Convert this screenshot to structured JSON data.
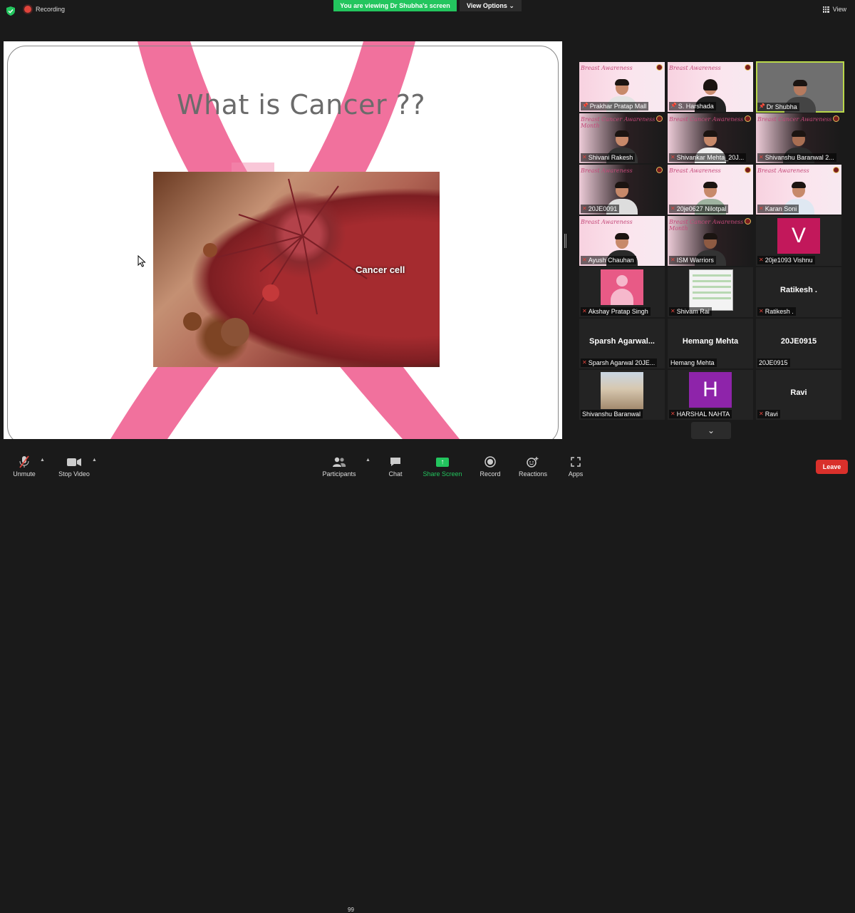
{
  "topbar": {
    "recording_label": "Recording",
    "viewing_banner": "You are viewing Dr Shubha's screen",
    "view_options_label": "View Options ⌄",
    "view_label": "View"
  },
  "slide": {
    "title": "What is Cancer ??",
    "image_caption": "Cancer cell"
  },
  "participants": [
    {
      "name": "Prakhar Pratap Mall",
      "banner": "Breast Awareness"
    },
    {
      "name": "S. Harshada",
      "banner": "Breast Awareness"
    },
    {
      "name": "Dr Shubha",
      "banner": ""
    },
    {
      "name": "Shivani Rakesh",
      "banner": "Breast Cancer Awareness Month"
    },
    {
      "name": "Shivankar Mehta_20J...",
      "banner": "Breast Cancer Awareness"
    },
    {
      "name": "Shivanshu Baranwal 2...",
      "banner": "Breast Cancer Awareness"
    },
    {
      "name": "20JE0091",
      "banner": "Breast Awareness"
    },
    {
      "name": "20je0627 Nilotpal",
      "banner": "Breast Awareness"
    },
    {
      "name": "Karan Soni",
      "banner": "Breast Awareness"
    },
    {
      "name": "Ayush Chauhan",
      "banner": "Breast Awareness"
    },
    {
      "name": "ISM Warriors",
      "banner": "Breast Cancer Awareness Month"
    },
    {
      "name": "20je1093 Vishnu",
      "avatar_letter": "V",
      "avatar_color": "#c2185b"
    },
    {
      "name": "Akshay Pratap Singh"
    },
    {
      "name": "Shivam Rai"
    },
    {
      "name": "Ratikesh .",
      "center_name": "Ratikesh ."
    },
    {
      "name": "Sparsh Agarwal 20JE...",
      "center_name": "Sparsh  Agarwal..."
    },
    {
      "name": "Hemang Mehta",
      "center_name": "Hemang Mehta"
    },
    {
      "name": "20JE0915",
      "center_name": "20JE0915"
    },
    {
      "name": "Shivanshu Baranwal"
    },
    {
      "name": "HARSHAL NAHTA",
      "avatar_letter": "H",
      "avatar_color": "#8e24aa"
    },
    {
      "name": "Ravi",
      "center_name": "Ravi"
    }
  ],
  "toolbar": {
    "unmute": "Unmute",
    "stop_video": "Stop Video",
    "participants": "Participants",
    "participant_count": "99",
    "chat": "Chat",
    "share_screen": "Share Screen",
    "record": "Record",
    "reactions": "Reactions",
    "apps": "Apps",
    "leave": "Leave"
  },
  "colors": {
    "accent_green": "#23c55e",
    "leave_red": "#d9302b",
    "active_speaker": "#b9d84a",
    "ribbon_pink": "#f06292"
  }
}
